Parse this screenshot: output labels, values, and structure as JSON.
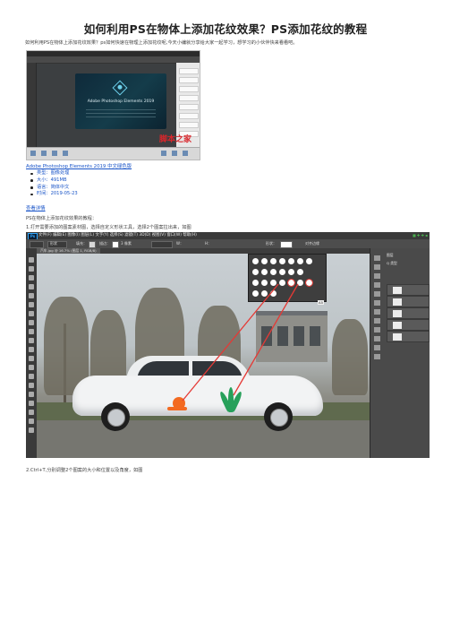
{
  "article": {
    "title": "如何利用PS在物体上添加花纹效果？PS添加花纹的教程",
    "intro": "如何利用PS在物体上添加花纹效果？ps如何快速在物理上添加花纹呢,今天小编就分享给大家一起学习，想学习的小伙伴快来看看吧。",
    "download_link": "Adobe Photoshop Elements 2019 中文绿色版",
    "meta": {
      "type": "类型：图像处理",
      "size": "大小：491MB",
      "lang": "语言：简体中文",
      "date": "时间：2019-05-23"
    },
    "detail_link": "查看详情",
    "step_intro": "PS在物体上添加花纹效果的教程：",
    "step1": "1.打开需要添加的图案素材图，选择自定义形状工具，选择2个图案拉出来，如图",
    "step2": "2.Ctrl+T,分别调整2个图案的大小和位置以及角度，如图"
  },
  "shot1": {
    "splash_name": "Adobe Photoshop Elements 2019",
    "watermark": "脚本之家"
  },
  "shot2": {
    "app_logo": "Ps",
    "menu": "文件(F)   编辑(E)   图像(I)   图层(L)   文字(Y)   选择(S)   滤镜(T)   3D(D)   视图(V)   窗口(W)   帮助(H)",
    "options": {
      "mode": "形状",
      "fill": "填充：",
      "stroke": "描边：",
      "stroke_width": "3 像素",
      "w": "W：",
      "h": "H：",
      "shape_label": "形状：",
      "align": "对齐边缘"
    },
    "doc_tab": "汽车.jpg @ 16.7% (图层 1, RGB/8)",
    "tooltip": "A5",
    "panel_header": "图层",
    "panel_kind": "Q 类型",
    "badge": "SO\n4",
    "accent_red": "#e53935",
    "snail_color": "#f36a21",
    "plant_color": "#27a05a"
  },
  "colors": {
    "link": "#1a55c8",
    "text": "#444444"
  }
}
